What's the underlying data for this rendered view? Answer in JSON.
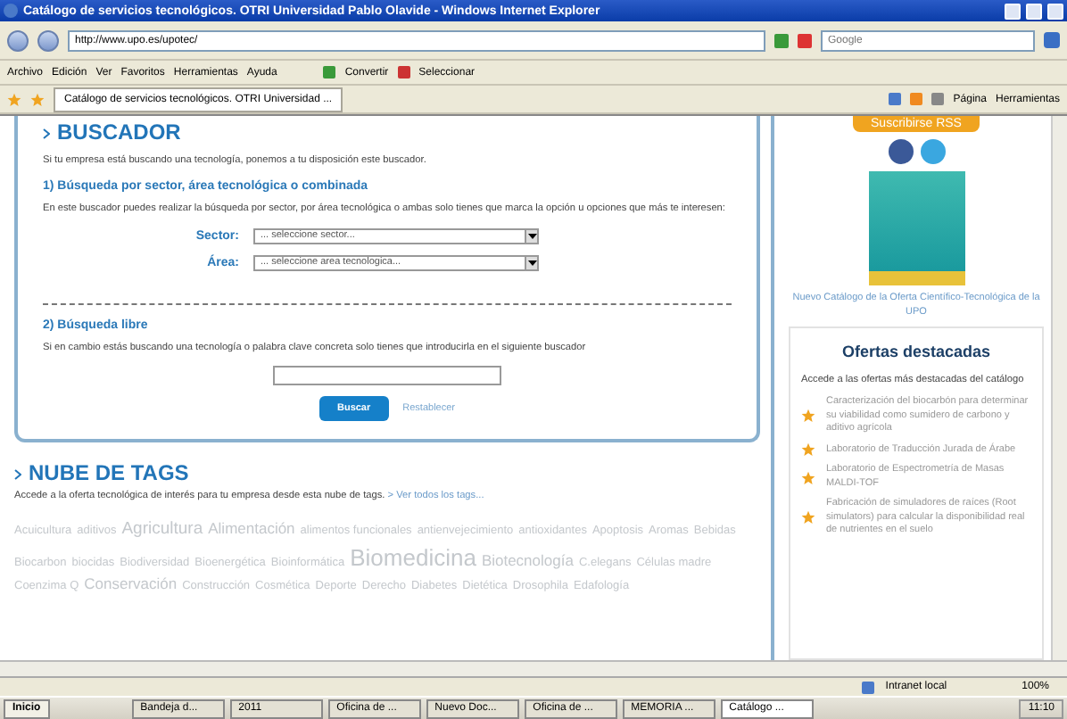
{
  "window": {
    "title": "Catálogo de servicios tecnológicos. OTRI Universidad Pablo Olavide - Windows Internet Explorer"
  },
  "address_bar": {
    "url": "http://www.upo.es/upotec/",
    "search_placeholder": "Google"
  },
  "menu": [
    "Archivo",
    "Edición",
    "Ver",
    "Favoritos",
    "Herramientas",
    "Ayuda"
  ],
  "commands": [
    "Convertir",
    "Seleccionar"
  ],
  "tabs": [
    {
      "label": "Catálogo de servicios tecnológicos. OTRI Universidad ...",
      "selected": true
    }
  ],
  "page_tools": [
    "Página",
    "Herramientas"
  ],
  "buscador": {
    "title": "BUSCADOR",
    "intro": "Si tu empresa está buscando una tecnología, ponemos a tu disposición este buscador.",
    "section1": {
      "heading": "1) Búsqueda por sector, área tecnológica o combinada",
      "text": "En este buscador puedes realizar la búsqueda por sector, por área tecnológica o ambas solo tienes que marca la opción u opciones que más te interesen:"
    },
    "fields": [
      {
        "label": "Sector:",
        "value": "... seleccione sector..."
      },
      {
        "label": "Área:",
        "value": "... seleccione area tecnologica..."
      }
    ],
    "section2": {
      "heading": "2) Búsqueda libre",
      "text": "Si en cambio estás buscando una tecnología o palabra clave concreta solo tienes que introducirla en el siguiente buscador"
    },
    "buttons": [
      {
        "label": "Buscar",
        "kind": "primary"
      },
      {
        "label": "Restablecer",
        "kind": "link"
      }
    ]
  },
  "tags": {
    "title": "NUBE DE TAGS",
    "text": "Accede a la oferta tecnológica de interés para tu empresa desde esta nube de tags.",
    "link": "> Ver todos los tags...",
    "items": [
      {
        "label": "Acuicultura",
        "kind": "small"
      },
      {
        "label": "aditivos",
        "kind": "small"
      },
      {
        "label": "Agricultura",
        "kind": "large"
      },
      {
        "label": "Alimentación",
        "kind": "medium"
      },
      {
        "label": "alimentos funcionales",
        "kind": "small"
      },
      {
        "label": "antienvejecimiento",
        "kind": "small"
      },
      {
        "label": "antioxidantes",
        "kind": "small"
      },
      {
        "label": "Apoptosis",
        "kind": "small"
      },
      {
        "label": "Aromas",
        "kind": "small"
      },
      {
        "label": "Bebidas",
        "kind": "small"
      },
      {
        "label": "Biocarbon",
        "kind": "small"
      },
      {
        "label": "biocidas",
        "kind": "small"
      },
      {
        "label": "Biodiversidad",
        "kind": "small"
      },
      {
        "label": "Bioenergética",
        "kind": "small"
      },
      {
        "label": "Bioinformática",
        "kind": "small"
      },
      {
        "label": "Biomedicina",
        "kind": "huge"
      },
      {
        "label": "Biotecnología",
        "kind": "medium"
      },
      {
        "label": "C.elegans",
        "kind": "small"
      },
      {
        "label": "Células madre",
        "kind": "small"
      },
      {
        "label": "Coenzima Q",
        "kind": "small"
      },
      {
        "label": "Conservación",
        "kind": "medium"
      },
      {
        "label": "Construcción",
        "kind": "small"
      },
      {
        "label": "Cosmética",
        "kind": "small"
      },
      {
        "label": "Deporte",
        "kind": "small"
      },
      {
        "label": "Derecho",
        "kind": "small"
      },
      {
        "label": "Diabetes",
        "kind": "small"
      },
      {
        "label": "Dietética",
        "kind": "small"
      },
      {
        "label": "Drosophila",
        "kind": "small"
      },
      {
        "label": "Edafología",
        "kind": "small"
      }
    ]
  },
  "sidebar": {
    "rss_button": "Suscribirse RSS",
    "catalog_link": "Nuevo Catálogo de la Oferta Científico-Tecnológica de la UPO",
    "offers": {
      "title": "Ofertas destacadas",
      "text": "Accede a las ofertas más destacadas del catálogo",
      "items": [
        "Caracterización del biocarbón para determinar su viabilidad como sumidero de carbono y aditivo agrícola",
        "Laboratorio de Traducción Jurada de Árabe",
        "Laboratorio de Espectrometría de Masas MALDI-TOF",
        "Fabricación de simuladores de raíces (Root simulators) para calcular la disponibilidad real de nutrientes en el suelo"
      ]
    }
  },
  "status_bar": {
    "zone": "Intranet local",
    "zoom": "100%"
  },
  "taskbar": {
    "start": "Inicio",
    "items": [
      {
        "label": "Bandeja d...",
        "selected": false
      },
      {
        "label": "2011",
        "selected": false
      },
      {
        "label": "Oficina de ...",
        "selected": false
      },
      {
        "label": "Nuevo Doc...",
        "selected": false
      },
      {
        "label": "Oficina de ...",
        "selected": false
      },
      {
        "label": "MEMORIA ...",
        "selected": false
      },
      {
        "label": "Catálogo ...",
        "selected": true
      }
    ],
    "clock": "11:10"
  }
}
